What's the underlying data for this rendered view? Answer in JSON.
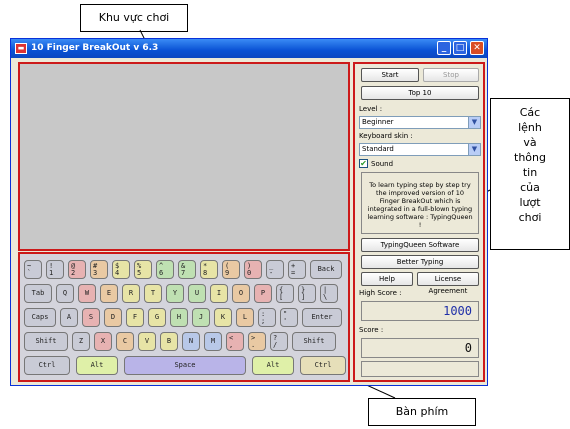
{
  "annotations": {
    "game_area": "Khu vực chơi",
    "controls": [
      "Các",
      "lệnh",
      "và",
      "thông",
      "tin",
      "của",
      "lượt",
      "chơi"
    ],
    "keyboard": "Bàn phím"
  },
  "window": {
    "title": "10 Finger BreakOut v 6.3",
    "icon": "breakout-app-icon"
  },
  "keyboard": {
    "rows": [
      [
        {
          "up": "~",
          "dn": "`",
          "color": "gray"
        },
        {
          "up": "!",
          "dn": "1",
          "color": "gray"
        },
        {
          "up": "@",
          "dn": "2",
          "color": "red"
        },
        {
          "up": "#",
          "dn": "3",
          "color": "orange"
        },
        {
          "up": "$",
          "dn": "4",
          "color": "yellow"
        },
        {
          "up": "%",
          "dn": "5",
          "color": "yellow"
        },
        {
          "up": "^",
          "dn": "6",
          "color": "green"
        },
        {
          "up": "&",
          "dn": "7",
          "color": "green"
        },
        {
          "up": "*",
          "dn": "8",
          "color": "yellow"
        },
        {
          "up": "(",
          "dn": "9",
          "color": "orange"
        },
        {
          "up": ")",
          "dn": "0",
          "color": "red"
        },
        {
          "up": "_",
          "dn": "-",
          "color": "gray"
        },
        {
          "up": "+",
          "dn": "=",
          "color": "gray"
        },
        {
          "label": "Back",
          "color": "gray"
        }
      ],
      [
        {
          "label": "Tab",
          "color": "gray"
        },
        {
          "label": "Q",
          "color": "gray"
        },
        {
          "label": "W",
          "color": "red"
        },
        {
          "label": "E",
          "color": "orange"
        },
        {
          "label": "R",
          "color": "yellow"
        },
        {
          "label": "T",
          "color": "yellow"
        },
        {
          "label": "Y",
          "color": "green"
        },
        {
          "label": "U",
          "color": "green"
        },
        {
          "label": "I",
          "color": "yellow"
        },
        {
          "label": "O",
          "color": "orange"
        },
        {
          "label": "P",
          "color": "red"
        },
        {
          "up": "{",
          "dn": "[",
          "color": "gray"
        },
        {
          "up": "}",
          "dn": "]",
          "color": "gray"
        },
        {
          "up": "|",
          "dn": "\\",
          "color": "gray"
        }
      ],
      [
        {
          "label": "Caps",
          "color": "gray"
        },
        {
          "label": "A",
          "color": "gray"
        },
        {
          "label": "S",
          "color": "red"
        },
        {
          "label": "D",
          "color": "orange"
        },
        {
          "label": "F",
          "color": "yellow"
        },
        {
          "label": "G",
          "color": "yellow"
        },
        {
          "label": "H",
          "color": "green"
        },
        {
          "label": "J",
          "color": "green"
        },
        {
          "label": "K",
          "color": "yellow"
        },
        {
          "label": "L",
          "color": "orange"
        },
        {
          "up": ":",
          "dn": ";",
          "color": "gray"
        },
        {
          "up": "\"",
          "dn": "'",
          "color": "gray"
        },
        {
          "label": "Enter",
          "color": "gray"
        }
      ],
      [
        {
          "label": "Shift",
          "color": "gray"
        },
        {
          "label": "Z",
          "color": "gray"
        },
        {
          "label": "X",
          "color": "red"
        },
        {
          "label": "C",
          "color": "orange"
        },
        {
          "label": "V",
          "color": "yellow"
        },
        {
          "label": "B",
          "color": "yellow"
        },
        {
          "label": "N",
          "color": "blue"
        },
        {
          "label": "M",
          "color": "blue"
        },
        {
          "up": "<",
          "dn": ",",
          "color": "red"
        },
        {
          "up": ">",
          "dn": ".",
          "color": "orange"
        },
        {
          "up": "?",
          "dn": "/",
          "color": "gray"
        },
        {
          "label": "Shift",
          "color": "gray"
        }
      ],
      [
        {
          "label": "Ctrl",
          "color": "gray"
        },
        {
          "label": "Alt",
          "color": "lime"
        },
        {
          "label": "Space",
          "color": "lav"
        },
        {
          "label": "Alt",
          "color": "lime"
        },
        {
          "label": "Ctrl",
          "color": "sand"
        }
      ]
    ]
  },
  "panel": {
    "start_label": "Start",
    "stop_label": "Stop",
    "top10_label": "Top 10",
    "level_label": "Level :",
    "level_value": "Beginner",
    "skin_label": "Keyboard skin :",
    "skin_value": "Standard",
    "sound_label": "Sound",
    "sound_checked": true,
    "info_text": "To learn typing step by step try the improved version of 10 Finger BreakOut which is integrated in a full-blown typing learning software : TypingQueen !",
    "typingqueen_label": "TypingQueen Software",
    "better_typing_label": "Better Typing",
    "help_label": "Help",
    "license_label": "License Agreement",
    "high_score_label": "High Score :",
    "high_score_value": "1000",
    "score_label": "Score :",
    "score_value": "0",
    "status_value": ""
  },
  "colors": {
    "highlight_border": "#cc1a1a",
    "titlebar": "#0a52d4",
    "high_score": "#1f2fa8"
  }
}
